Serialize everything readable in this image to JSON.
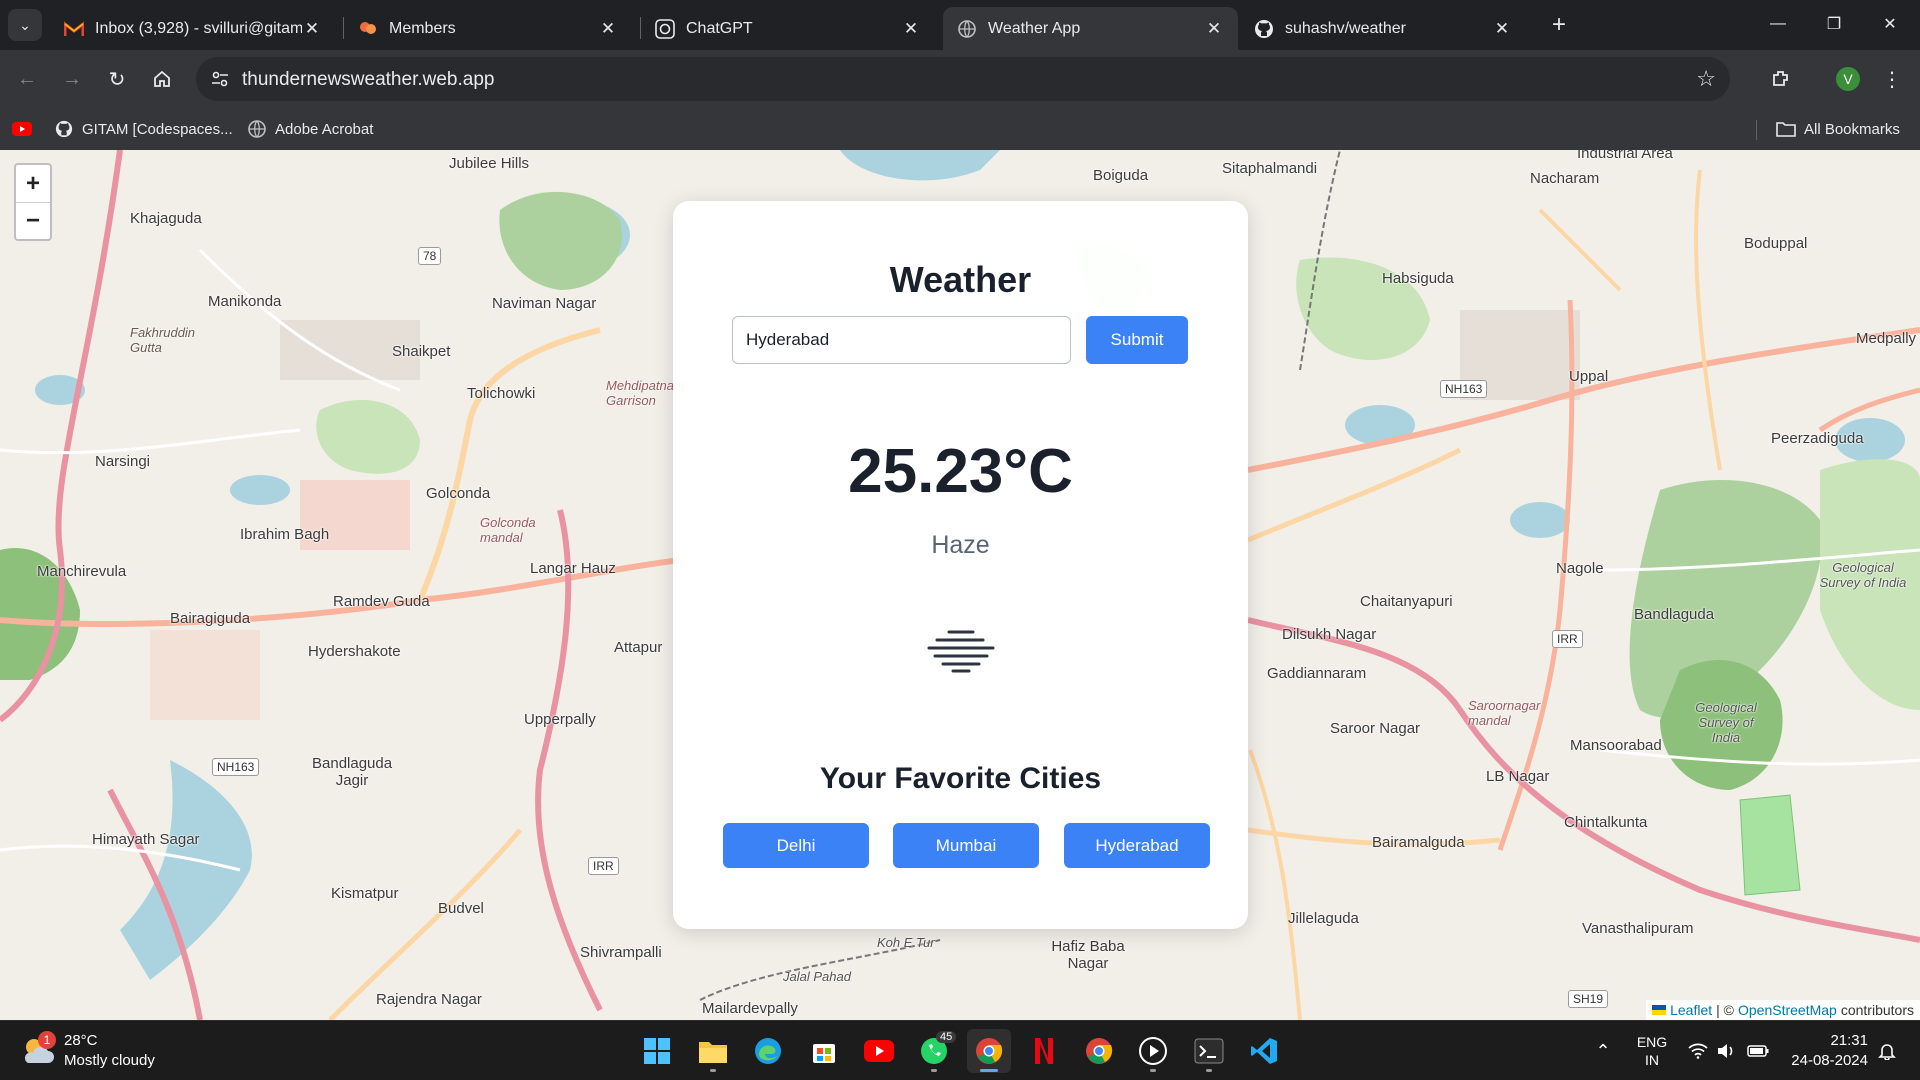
{
  "browser": {
    "tabs": [
      {
        "title": "Inbox (3,928) - svilluri@gitam.in",
        "icon": "gmail-icon",
        "active": false
      },
      {
        "title": "Members",
        "icon": "members-icon",
        "active": false
      },
      {
        "title": "ChatGPT",
        "icon": "chatgpt-icon",
        "active": false
      },
      {
        "title": "Weather App",
        "icon": "globe-icon",
        "active": true
      },
      {
        "title": "suhashv/weather",
        "icon": "github-icon",
        "active": false
      }
    ],
    "url": "thundernewsweather.web.app",
    "profile_initial": "V",
    "bookmarks": [
      {
        "label": "",
        "icon": "youtube-icon"
      },
      {
        "label": "GITAM [Codespaces...",
        "icon": "github-icon"
      },
      {
        "label": "Adobe Acrobat",
        "icon": "globe-icon"
      }
    ],
    "all_bookmarks_label": "All Bookmarks"
  },
  "map": {
    "zoom_in": "+",
    "zoom_out": "−",
    "labels": {
      "jubilee_hills": "Jubilee Hills",
      "khajaguda": "Khajaguda",
      "fakhruddin": "Fakhruddin Gutta",
      "manikonda": "Manikonda",
      "narsingi": "Narsingi",
      "navirman_nagar": "Naviman Nagar",
      "shaikpet": "Shaikpet",
      "tolichowki": "Tolichowki",
      "golconda": "Golconda",
      "ibrahim_bagh": "Ibrahim Bagh",
      "langar_hauz": "Langar Hauz",
      "ramdev_guda": "Ramdev Guda",
      "manchirevula": "Manchirevula",
      "bairaguda": "Bairagiguda",
      "hydershakote": "Hydershakote",
      "attapur": "Attapur",
      "upperpally": "Upperpally",
      "bandlaguda_jagir": "Bandlaguda Jagir",
      "himayath_sagar": "Himayath Sagar",
      "kismatpur": "Kismatpur",
      "budvel": "Budvel",
      "shivrampalli": "Shivrampalli",
      "rajendra_nagar": "Rajendra Nagar",
      "mailardevpally": "Mailardevpally",
      "boiguda": "Boiguda",
      "sitaphalmandi": "Sitaphalmandi",
      "nacharam": "Nacharam",
      "habsiguda": "Habsiguda",
      "boduppal": "Boduppal",
      "uppal": "Uppal",
      "medpally": "Medpally",
      "peerzadiguda": "Peerzadiguda",
      "nagole": "Nagole",
      "chaitanyapuri": "Chaitanyapuri",
      "dilsukh_nagar": "Dilsukh Nagar",
      "gaddiannaram": "Gaddiannaram",
      "bandlaguda": "Bandlaguda",
      "saroor_nagar": "Saroor Nagar",
      "mansoorabad": "Mansoorabad",
      "lb_nagar": "LB Nagar",
      "chintalkunta": "Chintalkunta",
      "bairamalguda": "Bairamalguda",
      "jillelaguda": "Jillelaguda",
      "vanasthalipuram": "Vanasthalipuram",
      "hafiz_baba_nagar": "Hafiz Baba Nagar",
      "industrial_area": "Industrial Area",
      "geological_survey_1": "Geological Survey of India",
      "geological_survey_2": "Geological Survey of India",
      "mehdipatnam_garrison": "Mehdipatnam Garrison",
      "golconda_mandal": "Golconda mandal",
      "saroornagar_mandal": "Saroornagar mandal",
      "jalal_pahad": "Jalal Pahad",
      "koh_e_tur": "Koh E Tur"
    },
    "shields": {
      "nh163_left": "NH163",
      "nh163_right": "NH163",
      "irr_left": "IRR",
      "irr_right": "IRR",
      "sh19": "SH19",
      "r78": "78"
    },
    "attribution": {
      "leaflet": "Leaflet",
      "sep": "| ©",
      "osm": "OpenStreetMap",
      "contributors": "contributors"
    }
  },
  "weather": {
    "title": "Weather",
    "city_value": "Hyderabad",
    "submit_label": "Submit",
    "temperature": "25.23°C",
    "condition": "Haze",
    "icon": "haze-icon",
    "favorites_title": "Your Favorite Cities",
    "favorites": [
      "Delhi",
      "Mumbai",
      "Hyderabad"
    ],
    "accent_color": "#3b82f6"
  },
  "taskbar": {
    "weather_temp": "28°C",
    "weather_desc": "Mostly cloudy",
    "weather_badge": "1",
    "whatsapp_badge": "45",
    "lang_1": "ENG",
    "lang_2": "IN",
    "time": "21:31",
    "date": "24-08-2024"
  }
}
